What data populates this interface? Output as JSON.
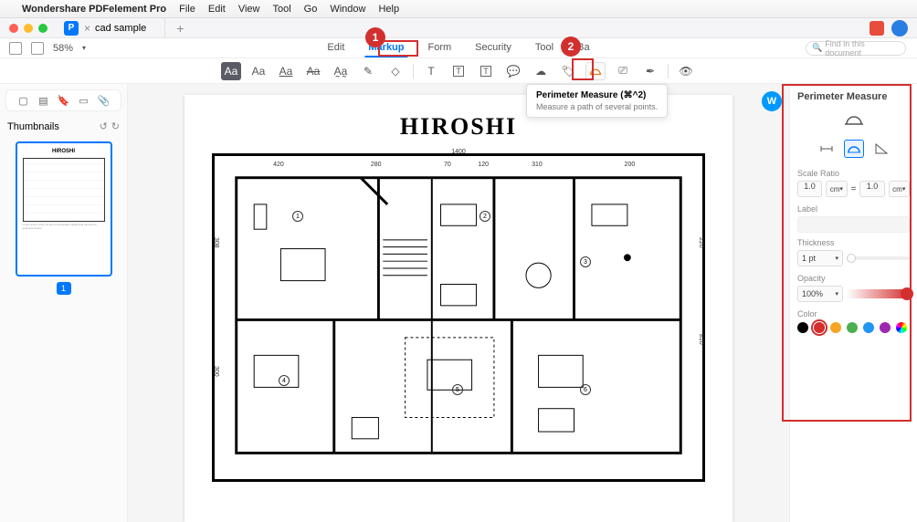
{
  "menubar": {
    "app": "Wondershare PDFelement Pro",
    "items": [
      "File",
      "Edit",
      "View",
      "Tool",
      "Go",
      "Window",
      "Help"
    ]
  },
  "tab": {
    "name": "cad sample"
  },
  "zoom": "58%",
  "ribbon": {
    "tabs": [
      "Edit",
      "Markup",
      "Form",
      "Security",
      "Tool",
      "Ba"
    ],
    "active": 1
  },
  "search_placeholder": "Find in this document",
  "annotations": {
    "marker1": "1",
    "marker2": "2"
  },
  "tooltip": {
    "title": "Perimeter Measure (⌘^2)",
    "desc": "Measure a path of several points."
  },
  "sidebar": {
    "title": "Thumbnails",
    "page_num": "1"
  },
  "document": {
    "title": "HIROSHI",
    "width_label": "1400",
    "dims_top": [
      "420",
      "280",
      "70",
      "120",
      "310",
      "200"
    ],
    "dims_side": {
      "left_upper": "308",
      "left_lower": "300",
      "right_upper": "220",
      "right_lower": "810"
    },
    "rooms": [
      "1",
      "2",
      "3",
      "4",
      "5",
      "6"
    ]
  },
  "rightpanel": {
    "title": "Perimeter Measure",
    "scale_label": "Scale Ratio",
    "scale_from": "1.0",
    "scale_from_unit": "cm",
    "scale_to": "1.0",
    "scale_to_unit": "cm",
    "eq": "=",
    "label_label": "Label",
    "thickness_label": "Thickness",
    "thickness_value": "1 pt",
    "opacity_label": "Opacity",
    "opacity_value": "100%",
    "color_label": "Color",
    "colors": [
      "#000000",
      "#d32f2f",
      "#f5a623",
      "#4caf50",
      "#2196f3",
      "#9c27b0"
    ],
    "selected_color": 1
  }
}
